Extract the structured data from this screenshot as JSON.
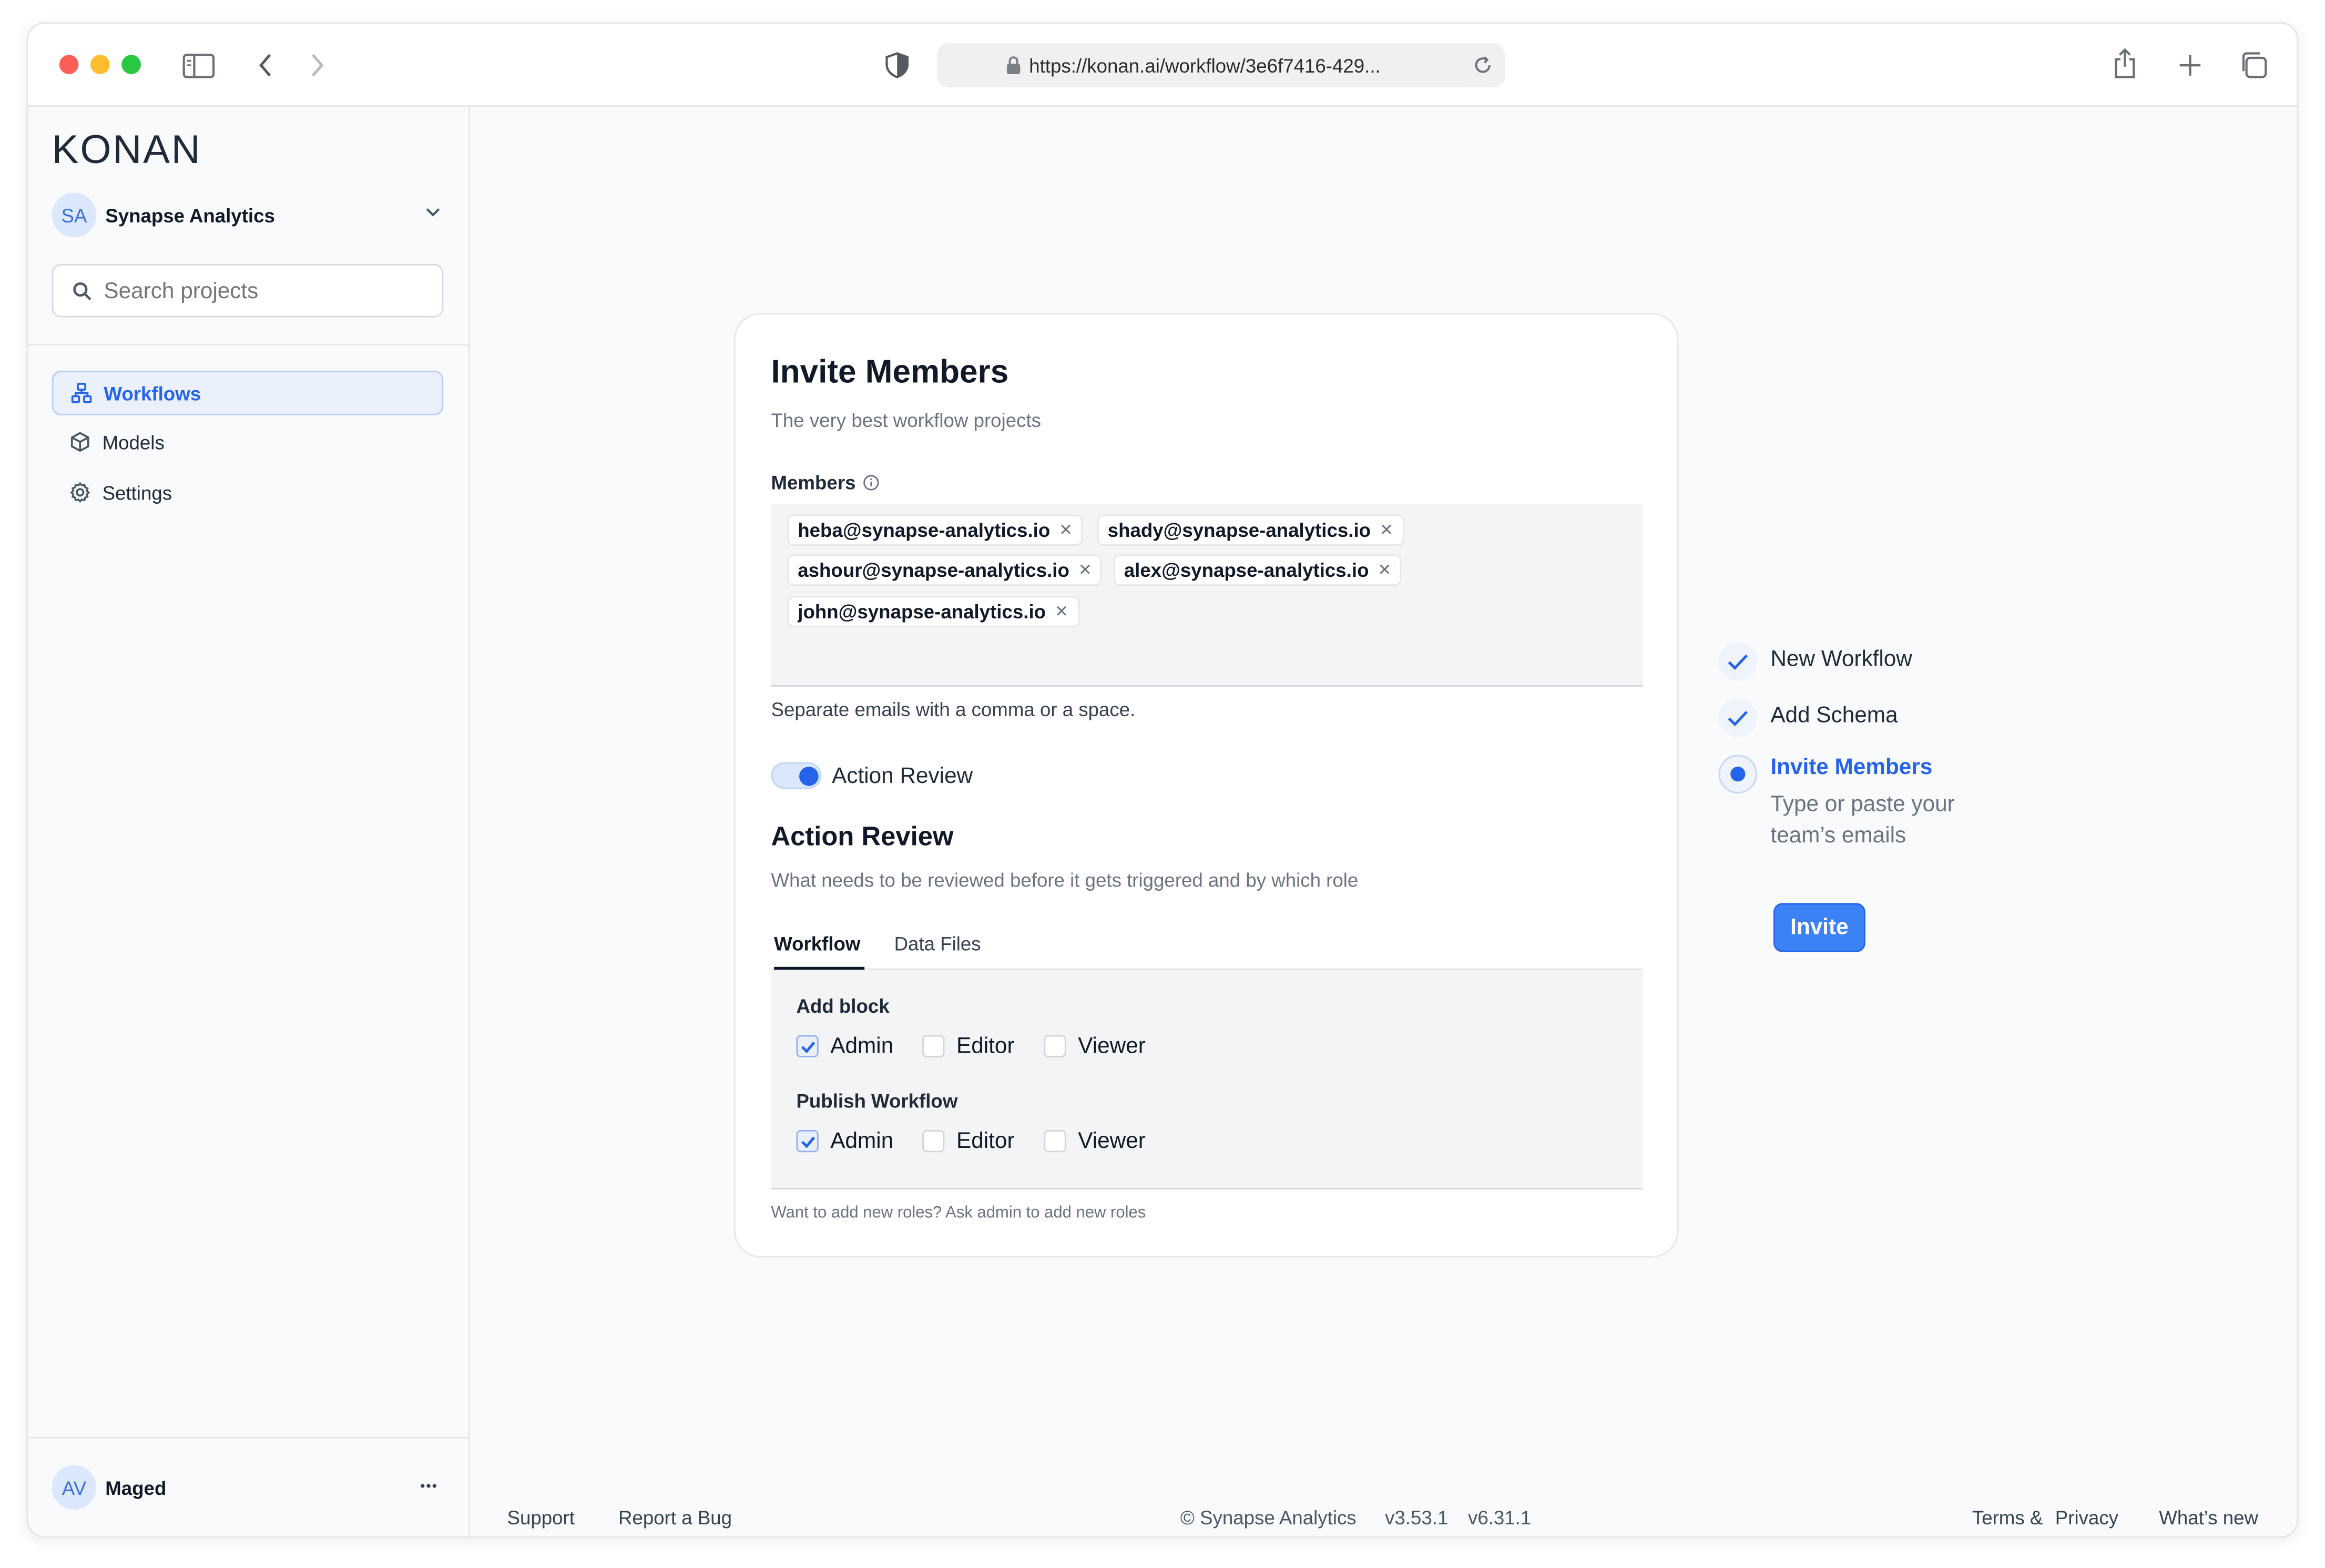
{
  "browser": {
    "url": "https://konan.ai/workflow/3e6f7416-429..."
  },
  "sidebar": {
    "logo": "KONAN",
    "org": {
      "initials": "SA",
      "name": "Synapse Analytics"
    },
    "search_placeholder": "Search projects",
    "nav": [
      {
        "label": "Workflows",
        "icon": "workflow-icon",
        "active": true
      },
      {
        "label": "Models",
        "icon": "cube-icon",
        "active": false
      },
      {
        "label": "Settings",
        "icon": "gear-icon",
        "active": false
      }
    ],
    "user": {
      "initials": "AV",
      "name": "Maged"
    }
  },
  "card": {
    "title": "Invite Members",
    "subtitle": "The very best workflow projects",
    "members_label": "Members",
    "members": [
      "heba@synapse-analytics.io",
      "shady@synapse-analytics.io",
      "ashour@synapse-analytics.io",
      "alex@synapse-analytics.io",
      "john@synapse-analytics.io"
    ],
    "members_hint": "Separate emails with a comma or a space.",
    "toggle_label": "Action Review",
    "toggle_on": true,
    "review_title": "Action Review",
    "review_subtitle": "What needs to be reviewed before it gets triggered and by which role",
    "tabs": [
      {
        "label": "Workflow",
        "active": true
      },
      {
        "label": "Data Files",
        "active": false
      }
    ],
    "groups": [
      {
        "title": "Add block",
        "roles": [
          {
            "label": "Admin",
            "checked": true
          },
          {
            "label": "Editor",
            "checked": false
          },
          {
            "label": "Viewer",
            "checked": false
          }
        ]
      },
      {
        "title": "Publish Workflow",
        "roles": [
          {
            "label": "Admin",
            "checked": true
          },
          {
            "label": "Editor",
            "checked": false
          },
          {
            "label": "Viewer",
            "checked": false
          }
        ]
      }
    ],
    "footnote": "Want to add new roles? Ask admin to add new roles"
  },
  "steps": [
    {
      "title": "New Workflow",
      "state": "done"
    },
    {
      "title": "Add Schema",
      "state": "done"
    },
    {
      "title": "Invite Members",
      "state": "current",
      "description": "Type or paste your team’s emails"
    }
  ],
  "invite_label": "Invite",
  "footer": {
    "support": "Support",
    "report": "Report a Bug",
    "copyright": "© Synapse Analytics",
    "v1": "v3.53.1",
    "v2": "v6.31.1",
    "terms": "Terms &",
    "privacy": "Privacy",
    "whats_new": "What’s new"
  },
  "colors": {
    "accent": "#2563eb",
    "button": "#3b82f6",
    "traffic": [
      "#fe5f57",
      "#febc2e",
      "#28c840"
    ]
  }
}
